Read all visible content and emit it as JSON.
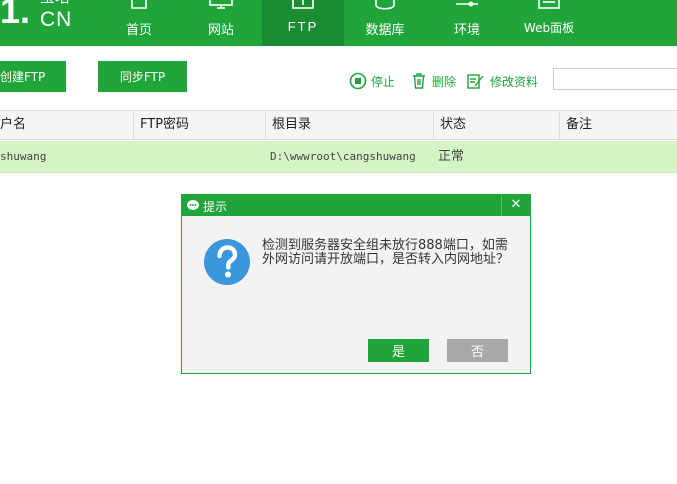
{
  "logo": {
    "mark": "1.",
    "text": "CN",
    "han": "宝塔"
  },
  "nav": {
    "items": [
      {
        "label": "首页",
        "icon": "home-icon"
      },
      {
        "label": "网站",
        "icon": "monitor-icon"
      },
      {
        "label": "FTP",
        "icon": "ftp-icon"
      },
      {
        "label": "数据库",
        "icon": "database-icon"
      },
      {
        "label": "环境",
        "icon": "sliders-icon"
      },
      {
        "label": "Web面板",
        "icon": "panel-icon"
      }
    ],
    "active": "FTP"
  },
  "toolbar": {
    "create_label": "创建FTP",
    "sync_label": "同步FTP",
    "stop_label": "停止",
    "delete_label": "删除",
    "edit_label": "修改资料"
  },
  "table": {
    "headers": [
      "户名",
      "FTP密码",
      "根目录",
      "状态",
      "备注"
    ],
    "rows": [
      {
        "user": "shuwang",
        "password": "",
        "root": "D:\\wwwroot\\cangshuwang",
        "status": "正常",
        "note": ""
      }
    ]
  },
  "dialog": {
    "title": "提示",
    "close": "✕",
    "message": "检测到服务器安全组未放行888端口，如需外网访问请开放端口，是否转入内网地址？",
    "yes_label": "是",
    "no_label": "否"
  },
  "colors": {
    "accent": "#20a53a",
    "row_highlight": "#d4f4c6",
    "question_icon": "#3c96dc"
  }
}
